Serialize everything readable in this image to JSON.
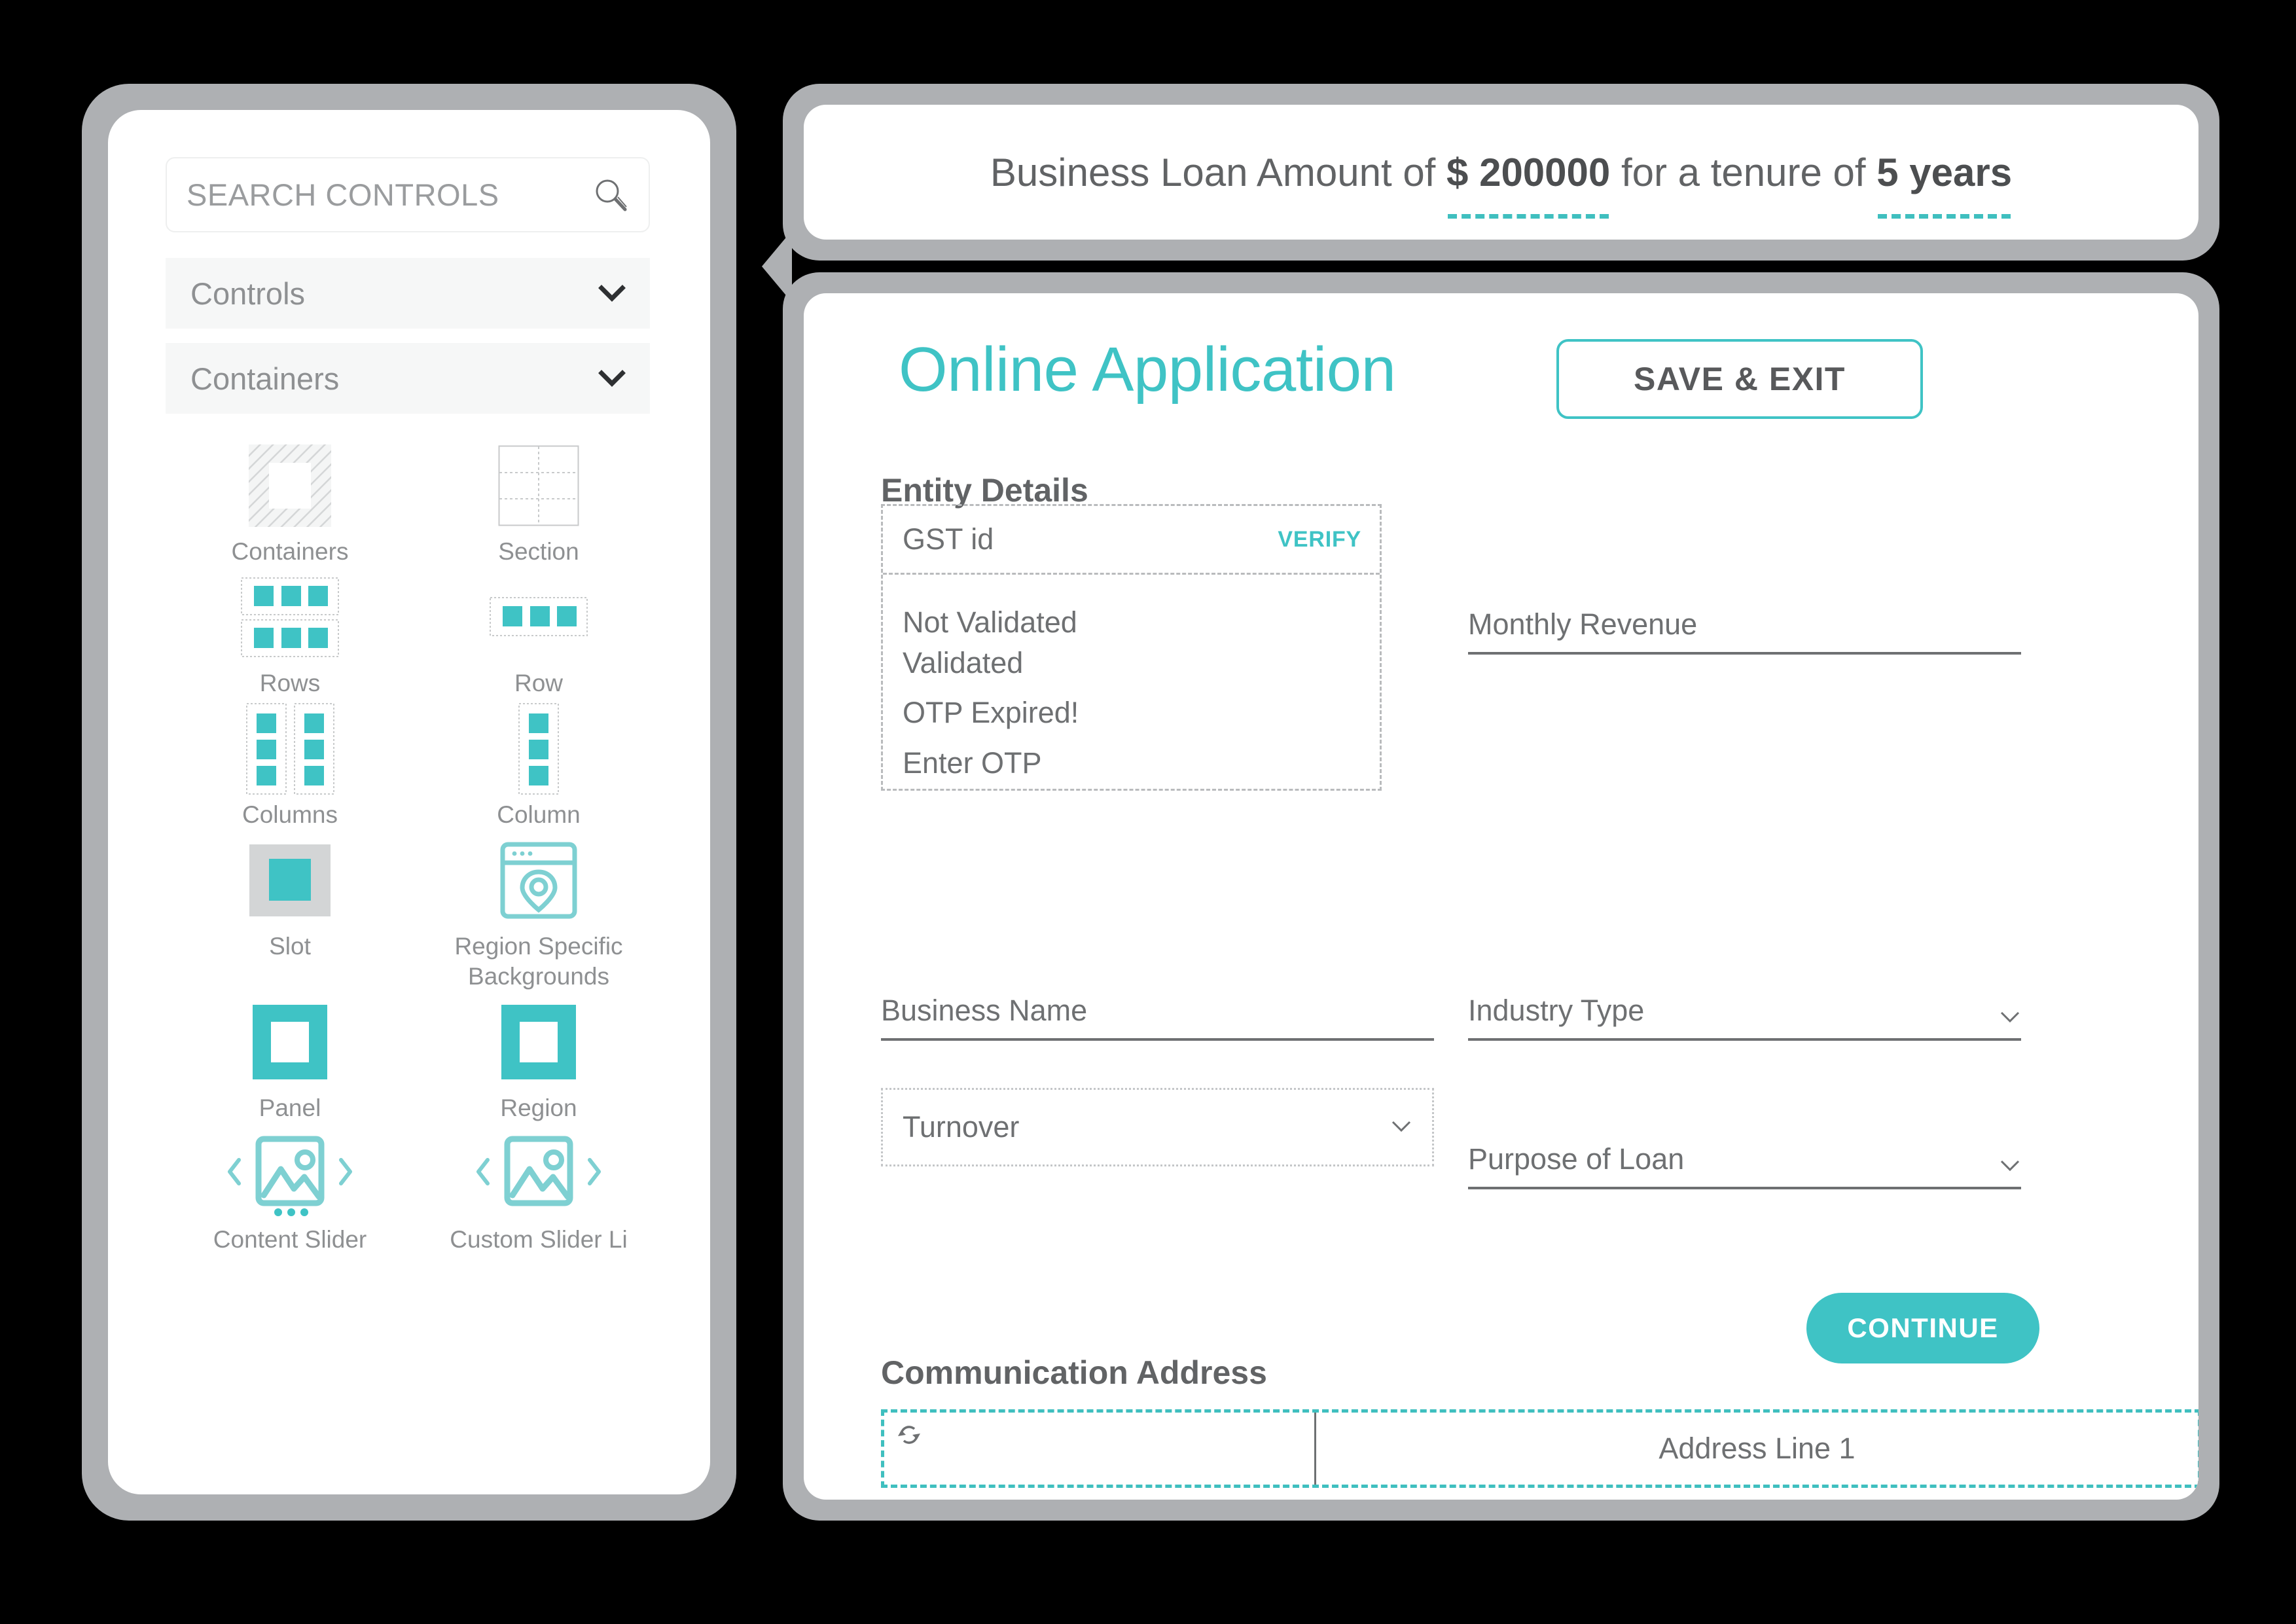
{
  "palette": {
    "search": {
      "placeholder": "SEARCH CONTROLS",
      "icon": "search-icon"
    },
    "accordions": [
      {
        "label": "Controls",
        "icon": "chevron-down-icon"
      },
      {
        "label": "Containers",
        "icon": "chevron-down-icon"
      }
    ],
    "items": [
      {
        "label": "Containers",
        "icon": "containers-icon"
      },
      {
        "label": "Section",
        "icon": "section-grid-icon"
      },
      {
        "label": "Rows",
        "icon": "rows-icon"
      },
      {
        "label": "Row",
        "icon": "row-icon"
      },
      {
        "label": "Columns",
        "icon": "columns-icon"
      },
      {
        "label": "Column",
        "icon": "column-icon"
      },
      {
        "label": "Slot",
        "icon": "slot-icon"
      },
      {
        "label": "Region Specific Backgrounds",
        "icon": "region-background-pin-icon"
      },
      {
        "label": "Panel",
        "icon": "panel-icon"
      },
      {
        "label": "Region",
        "icon": "region-icon"
      },
      {
        "label": "Content Slider",
        "icon": "content-slider-icon"
      },
      {
        "label": "Custom Slider Li",
        "icon": "custom-slider-icon"
      }
    ]
  },
  "banner": {
    "prefix": "Business Loan Amount of ",
    "amount": "$ 200000",
    "middle": " for a tenure of ",
    "tenure": "5 years"
  },
  "form": {
    "title": "Online Application",
    "save_exit_label": "SAVE & EXIT",
    "entity_heading": "Entity Details",
    "gst": {
      "label": "GST id",
      "verify_label": "VERIFY",
      "statuses": [
        "Not Validated",
        "Validated",
        "OTP Expired!"
      ],
      "otp_label": "Enter OTP"
    },
    "fields": {
      "monthly_revenue": "Monthly Revenue",
      "business_name": "Business Name",
      "industry_type": "Industry Type",
      "turnover": "Turnover",
      "purpose_of_loan": "Purpose of Loan"
    },
    "continue_label": "CONTINUE",
    "comm_heading": "Communication Address",
    "address": {
      "sync_icon": "sync-refresh-icon",
      "line1_label": "Address Line 1"
    }
  },
  "colors": {
    "accent_teal": "#3FC3C5",
    "panel_border_gray": "#AEB0B3",
    "text_gray": "#6E7072",
    "muted_gray": "#8E9092"
  }
}
